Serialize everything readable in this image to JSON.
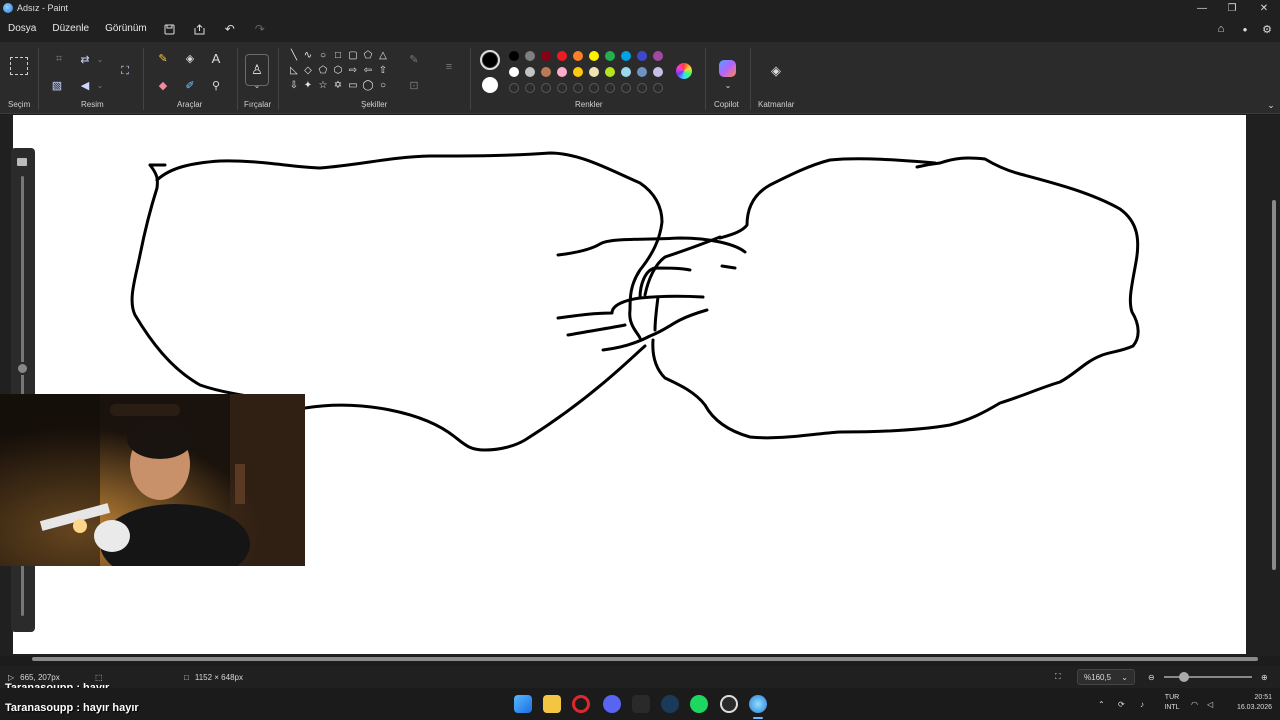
{
  "window": {
    "title": "Adsız - Paint"
  },
  "menu": {
    "items": [
      "Dosya",
      "Düzenle",
      "Görünüm"
    ]
  },
  "ribbon": {
    "groups": {
      "selection": "Seçim",
      "image": "Resim",
      "tools": "Araçlar",
      "brushes": "Fırçalar",
      "shapes": "Şekiller",
      "colors": "Renkler",
      "copilot": "Copilot",
      "layers": "Katmanlar"
    },
    "primary_color": "#000000",
    "secondary_color": "#ffffff",
    "palette_row1": [
      "#000000",
      "#7f7f7f",
      "#880015",
      "#ed1c24",
      "#ff7f27",
      "#fff200",
      "#22b14c",
      "#00a2e8",
      "#3f48cc",
      "#a349a4"
    ],
    "palette_row2": [
      "#ffffff",
      "#c3c3c3",
      "#b97a57",
      "#ffaec9",
      "#ffc90e",
      "#efe4b0",
      "#b5e61d",
      "#99d9ea",
      "#7092be",
      "#c8bfe7"
    ]
  },
  "status": {
    "cursor_position": "665, 207px",
    "canvas_size": "1152 × 648px",
    "zoom": "%160,5"
  },
  "chat": [
    {
      "user": "Taranasoupp",
      "message": "hayır"
    },
    {
      "user": "Taranasoupp",
      "message": "hayır hayır"
    }
  ],
  "taskbar": {
    "language_top": "TUR",
    "language_bottom": "INTL",
    "time": "20:51",
    "date": "16.03.2026"
  }
}
